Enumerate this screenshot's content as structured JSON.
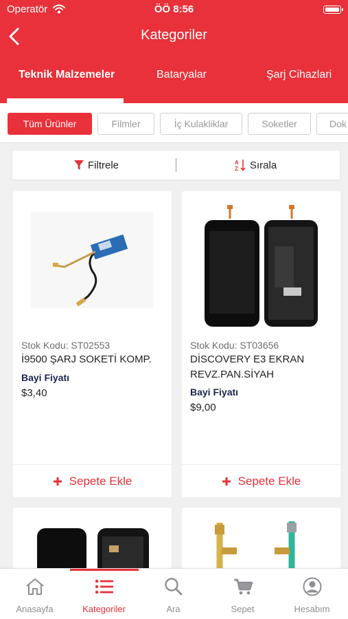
{
  "status_bar": {
    "carrier": "Operatör",
    "time": "ÖÖ 8:56"
  },
  "header": {
    "title": "Kategoriler"
  },
  "tabs": [
    "Teknik Malzemeler",
    "Bataryalar",
    "Şarj Cihazlari"
  ],
  "chips": [
    "Tüm Ürünler",
    "Filmler",
    "İç Kulakliklar",
    "Soketler",
    "Dok"
  ],
  "toolbar": {
    "filter_label": "Filtrele",
    "sort_label": "Sırala"
  },
  "products": [
    {
      "code": "Stok Kodu: ST02553",
      "name": "İ9500 ŞARJ SOKETİ KOMP.",
      "price_label": "Bayi Fiyatı",
      "price": "$3,40",
      "add_label": "Sepete Ekle"
    },
    {
      "code": "Stok Kodu: ST03656",
      "name": "DİSCOVERY E3 EKRAN REVZ.PAN.SİYAH",
      "price_label": "Bayi Fiyatı",
      "price": "$9,00",
      "add_label": "Sepete Ekle"
    }
  ],
  "tabbar": [
    "Anasayfa",
    "Kategoriler",
    "Ara",
    "Sepet",
    "Hesabım"
  ],
  "colors": {
    "accent": "#e8313a",
    "price_label": "#1b2550",
    "inactive_tab": "#8e8e93"
  }
}
